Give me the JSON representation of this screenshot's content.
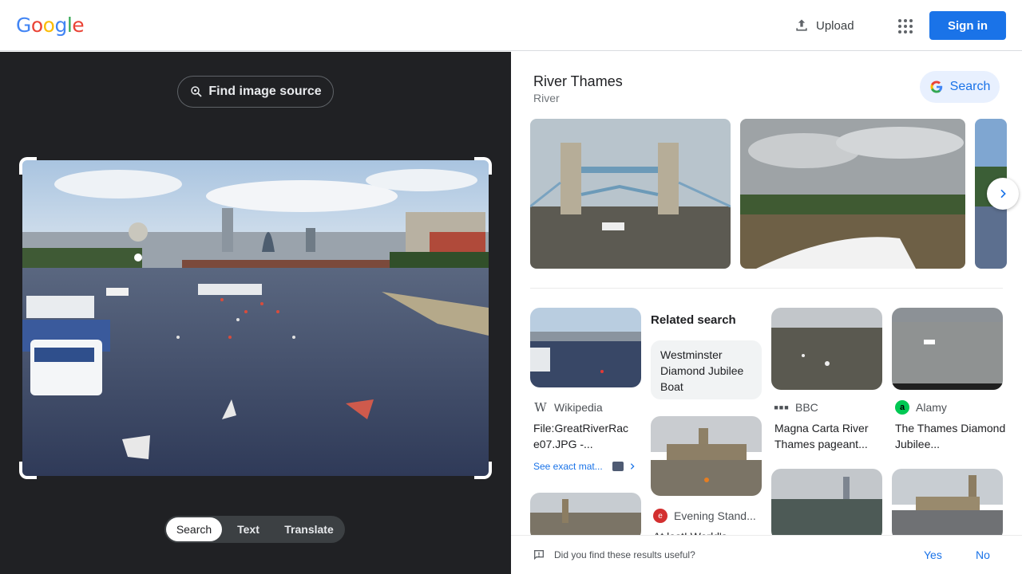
{
  "header": {
    "logo_letters": [
      "G",
      "o",
      "o",
      "g",
      "l",
      "e"
    ],
    "upload_label": "Upload",
    "signin_label": "Sign in"
  },
  "lens": {
    "find_source_label": "Find image source",
    "modes": [
      "Search",
      "Text",
      "Translate"
    ],
    "active_mode": "Search"
  },
  "entity": {
    "title": "River Thames",
    "subtitle": "River",
    "search_label": "Search"
  },
  "results": {
    "related_search_heading": "Related search",
    "related_search_chip": "Westminster Diamond Jubilee Boat",
    "cards": [
      {
        "source": "Wikipedia",
        "title": "File:GreatRiverRac e07.JPG -..."
      },
      {
        "source": "BBC",
        "title": "Magna Carta River Thames pageant..."
      },
      {
        "source": "Alamy",
        "title": "The Thames Diamond Jubilee..."
      },
      {
        "source": "Evening Stand...",
        "title": "At last! World's..."
      }
    ],
    "exact_match_label": "See exact mat..."
  },
  "feedback": {
    "question": "Did you find these results useful?",
    "yes_label": "Yes",
    "no_label": "No"
  },
  "colors": {
    "brand_blue": "#1a73e8",
    "panel_dark": "#202124"
  }
}
